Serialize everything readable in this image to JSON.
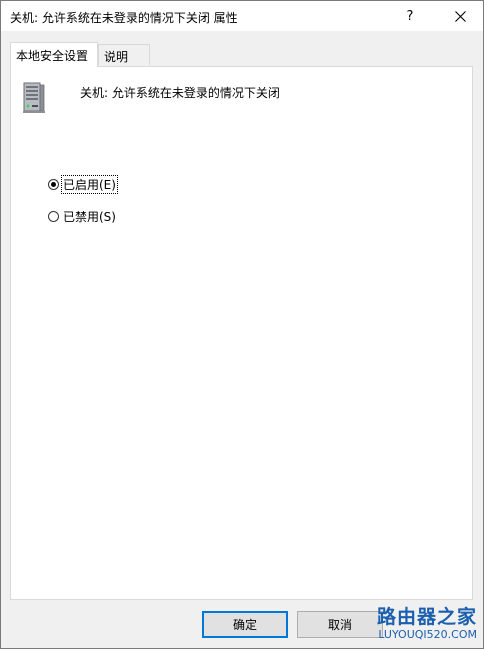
{
  "window": {
    "title": "关机: 允许系统在未登录的情况下关闭 属性",
    "help_label": "?",
    "close_icon": "close-icon"
  },
  "tabs": [
    {
      "label": "本地安全设置",
      "active": true
    },
    {
      "label": "说明",
      "active": false
    }
  ],
  "policy": {
    "icon": "server-icon",
    "name": "关机: 允许系统在未登录的情况下关闭"
  },
  "options": [
    {
      "label": "已启用(E)",
      "checked": true
    },
    {
      "label": "已禁用(S)",
      "checked": false
    }
  ],
  "buttons": {
    "ok_label": "确定",
    "cancel_label": "取消"
  },
  "watermark": {
    "title": "路由器之家",
    "url": "LUYOUQI520.COM"
  },
  "colors": {
    "accent": "#0078d7",
    "watermark": "#1b5fae"
  }
}
